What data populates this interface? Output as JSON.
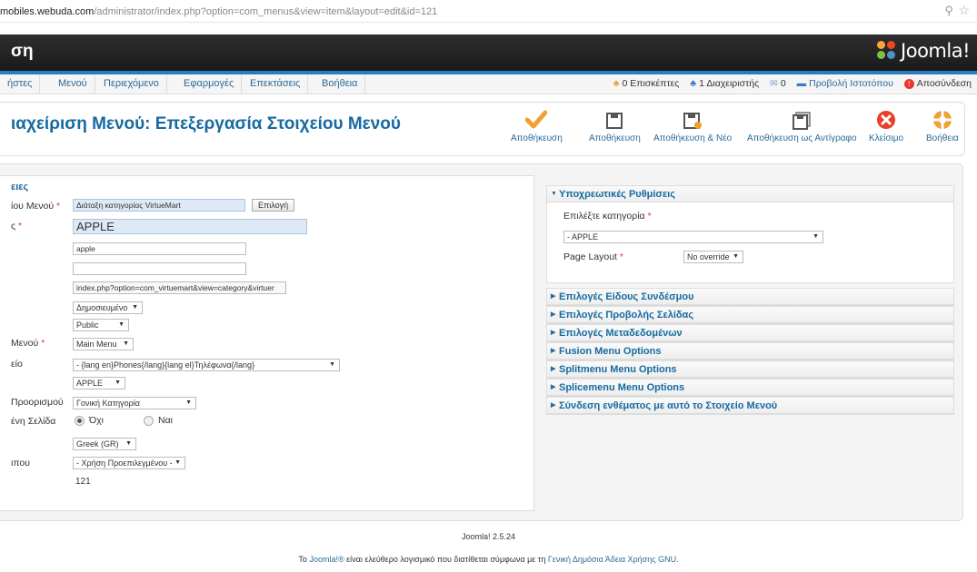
{
  "browser": {
    "url_prefix": "mobiles.webuda.com",
    "url_path": "/administrator/index.php?option=com_menus&view=item&layout=edit&id=121"
  },
  "header": {
    "title": "ση",
    "logo_text": "Joomla!"
  },
  "menubar": {
    "items": [
      "ήστες",
      "Μενού",
      "Περιεχόμενο",
      "Εφαρμογές",
      "Επεκτάσεις",
      "Βοήθεια"
    ],
    "visitors": "0 Επισκέπτες",
    "admins": "1 Διαχειριστής",
    "messages": "0",
    "view_site": "Προβολή Ιστοτόπου",
    "logout": "Αποσύνδεση"
  },
  "page": {
    "title": "ιαχείριση Μενού: Επεξεργασία Στοιχείου Μενού"
  },
  "toolbar": {
    "save": "Αποθήκευση",
    "save2": "Αποθήκευση",
    "save_new": "Αποθήκευση & Νέο",
    "save_copy": "Αποθήκευση ως Αντίγραφο",
    "close": "Κλείσιμο",
    "help": "Βοήθεια"
  },
  "form": {
    "legend": "ειες",
    "labels": {
      "type": "ίου Μενού",
      "title": "ς",
      "menu": "Μενού",
      "parent": "είο",
      "target": "Προορισμού",
      "home": "ένη Σελίδα",
      "template": "ιπου"
    },
    "type_value": "Διάταξη κατηγορίας VirtueMart",
    "select_button": "Επιλογή",
    "title_value": "APPLE",
    "alias_value": "apple",
    "note_value": "",
    "link_value": "index.php?option=com_virtuemart&view=category&virtuer",
    "status_value": "Δημοσιευμένο",
    "access_value": "Public",
    "menu_value": "Main Menu",
    "parent_value": "- {lang en}Phones{/lang}{lang el}Τηλέφωνα{/lang}",
    "order_value": "APPLE",
    "target_value": "Γονική Κατηγορία",
    "home_no": "Όχι",
    "home_yes": "Ναι",
    "language_value": "Greek (GR)",
    "template_value": "- Χρήση Προεπιλεγμένου -",
    "id_value": "121"
  },
  "required_panel": {
    "header": "Υποχρεωτικές Ρυθμίσεις",
    "category_label": "Επιλέξτε κατηγορία",
    "category_value": "- APPLE",
    "layout_label": "Page Layout",
    "layout_value": "No override"
  },
  "panels": [
    "Επιλογές Είδους Συνδέσμου",
    "Επιλογές Προβολής Σελίδας",
    "Επιλογές Μεταδεδομένων",
    "Fusion Menu Options",
    "Splitmenu Menu Options",
    "Splicemenu Menu Options",
    "Σύνδεση ενθέματος με αυτό το Στοιχείο Μενού"
  ],
  "footer": {
    "version": "Joomla! 2.5.24",
    "line_pre": "Το",
    "joomla_link": "Joomla!®",
    "line_mid": "είναι ελεύθερο λογισμικό που διατίθεται σύμφωνα με τη",
    "gpl_link": "Γενική Δημόσια Άδεια Χρήσης GNU."
  },
  "colors": {
    "accent": "#176aa1",
    "link": "#2b6b9a",
    "header_bg": "#222222",
    "strip": "#2b7cbf"
  }
}
